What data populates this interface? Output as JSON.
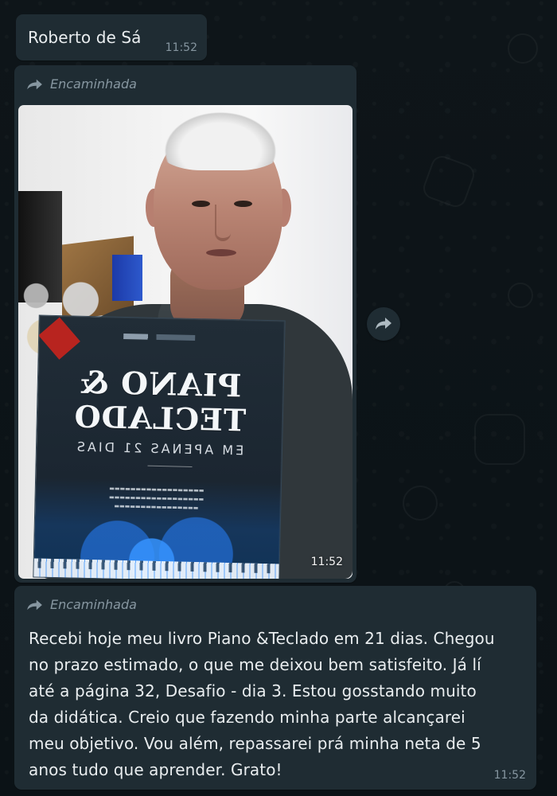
{
  "colors": {
    "background": "#0d1418",
    "bubble": "#1f2c33",
    "primary_text": "#e9edef",
    "secondary_text": "#8696a0"
  },
  "messages": [
    {
      "sender": "Roberto de Sá",
      "time": "11:52"
    },
    {
      "forward_label": "Encaminhada",
      "forward_icon": "forward-arrow-icon",
      "photo_time": "11:52",
      "book": {
        "title_line1": "PIANO &",
        "title_line2": "TECLADO",
        "subtitle": "EM APENAS 21 DIAS"
      }
    },
    {
      "forward_label": "Encaminhada",
      "forward_icon": "forward-arrow-icon",
      "text": "Recebi hoje meu livro Piano &Teclado em 21 dias. Chegou no prazo estimado, o que me deixou bem satisfeito. Já lí até a página 32, Desafio - dia 3. Estou gosstando muito da didática. Creio que fazendo minha parte alcançarei meu objetivo. Vou além, repassarei prá minha neta de 5 anos tudo que aprender. Grato!",
      "time": "11:52"
    }
  ],
  "actions": {
    "forward_icon": "forward-arrow-icon"
  }
}
